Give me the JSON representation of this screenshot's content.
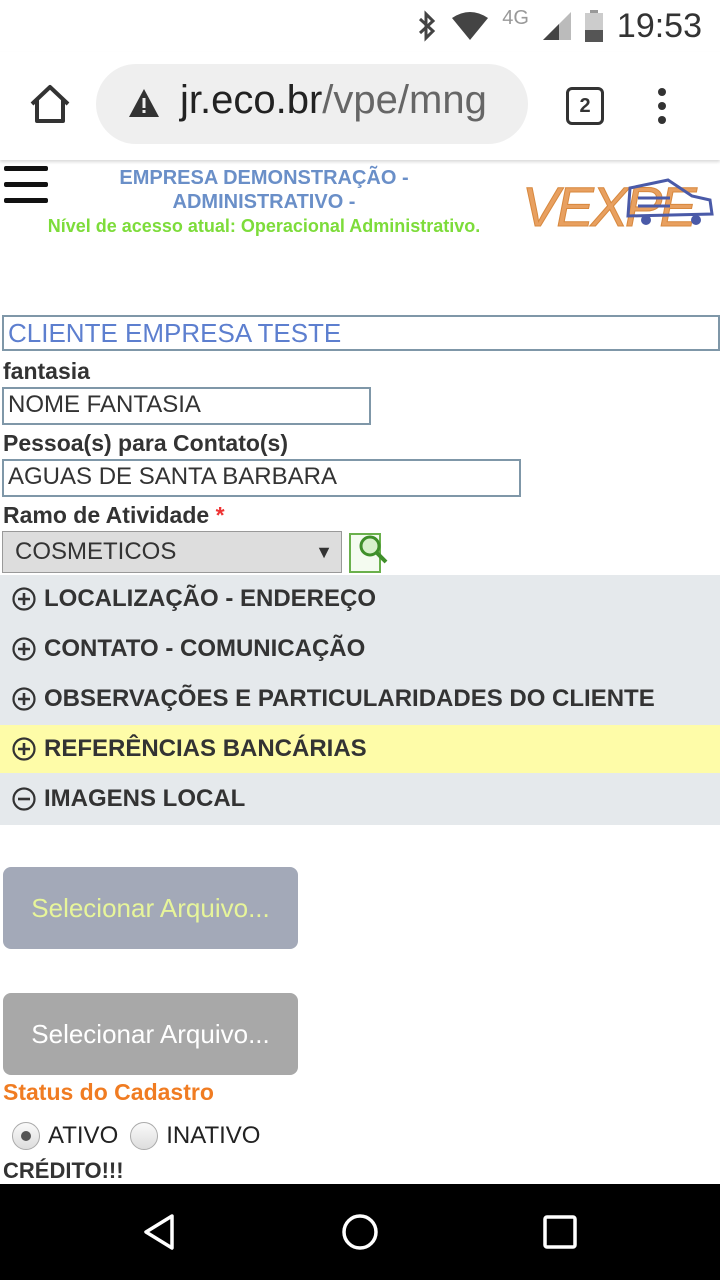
{
  "status_bar": {
    "time": "19:53",
    "network": "4G",
    "icons": [
      "bluetooth-icon",
      "wifi-icon",
      "signal-icon",
      "battery-icon"
    ]
  },
  "browser": {
    "url_domain": "jr.eco.br",
    "url_path": "/vpe/mng",
    "tab_count": "2"
  },
  "header": {
    "company_line1": "EMPRESA DEMONSTRAÇÃO -",
    "company_line2": "ADMINISTRATIVO -",
    "access_level": "Nível de acesso atual: Operacional Administrativo.",
    "logo_text": "VEXPE"
  },
  "form": {
    "client_name": "CLIENTE EMPRESA TESTE",
    "fantasia_label": "fantasia",
    "fantasia_value": "NOME FANTASIA",
    "contact_label": "Pessoa(s) para Contato(s)",
    "contact_value": "AGUAS DE SANTA BARBARA",
    "activity_label": "Ramo de Atividade",
    "activity_required": "*",
    "activity_value": "COSMETICOS"
  },
  "sections": [
    {
      "label": "LOCALIZAÇÃO - ENDEREÇO",
      "state": "collapsed"
    },
    {
      "label": "CONTATO - COMUNICAÇÃO",
      "state": "collapsed"
    },
    {
      "label": "OBSERVAÇÕES E PARTICULARIDADES DO CLIENTE",
      "state": "collapsed"
    },
    {
      "label": "REFERÊNCIAS BANCÁRIAS",
      "state": "collapsed"
    },
    {
      "label": "IMAGENS LOCAL",
      "state": "expanded"
    }
  ],
  "files": {
    "button1": "Selecionar Arquivo...",
    "button2": "Selecionar Arquivo..."
  },
  "status": {
    "title": "Status do Cadastro",
    "active": "ATIVO",
    "inactive": "INATIVO",
    "selected": "ATIVO"
  },
  "credit_label": "CRÉDITO!!!",
  "colors": {
    "link_blue": "#5d7fcf",
    "access_green": "#7ddc3a",
    "status_orange": "#f07c22",
    "highlight": "#fefca8",
    "accordion_bg": "#e5e9ec"
  }
}
